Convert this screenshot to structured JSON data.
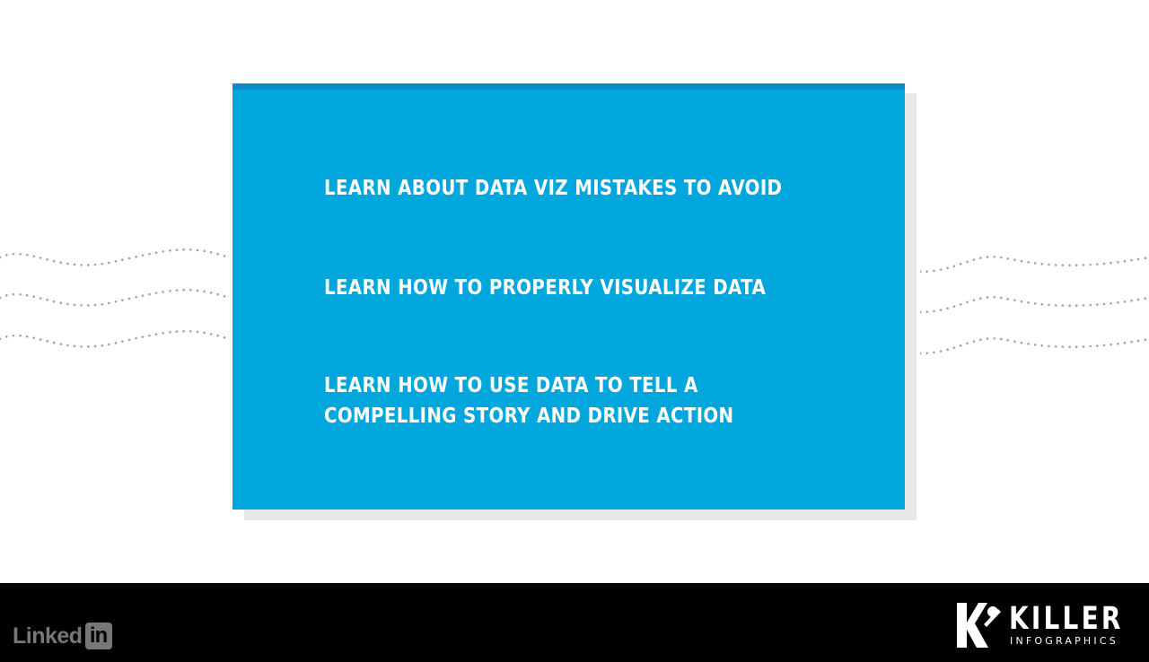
{
  "slide": {
    "background_color": "#ffffff",
    "card_color": "#00a6dc",
    "card_top_border_color": "#0a8cc8",
    "card_shadow_color": "#e6e7e8",
    "wave_dot_color": "#a0a4a8",
    "objectives": [
      {
        "lines": [
          "LEARN ABOUT DATA VIZ MISTAKES TO AVOID"
        ]
      },
      {
        "lines": [
          "LEARN HOW TO PROPERLY VISUALIZE DATA"
        ]
      },
      {
        "lines": [
          "LEARN HOW TO USE DATA TO TELL A",
          "COMPELLING STORY AND DRIVE ACTION"
        ]
      }
    ]
  },
  "footer": {
    "background_color": "#000000",
    "linkedin_word": "Linked",
    "linkedin_box": "in",
    "killer_word": "KILLER",
    "killer_sub": "INFOGRAPHICS"
  }
}
